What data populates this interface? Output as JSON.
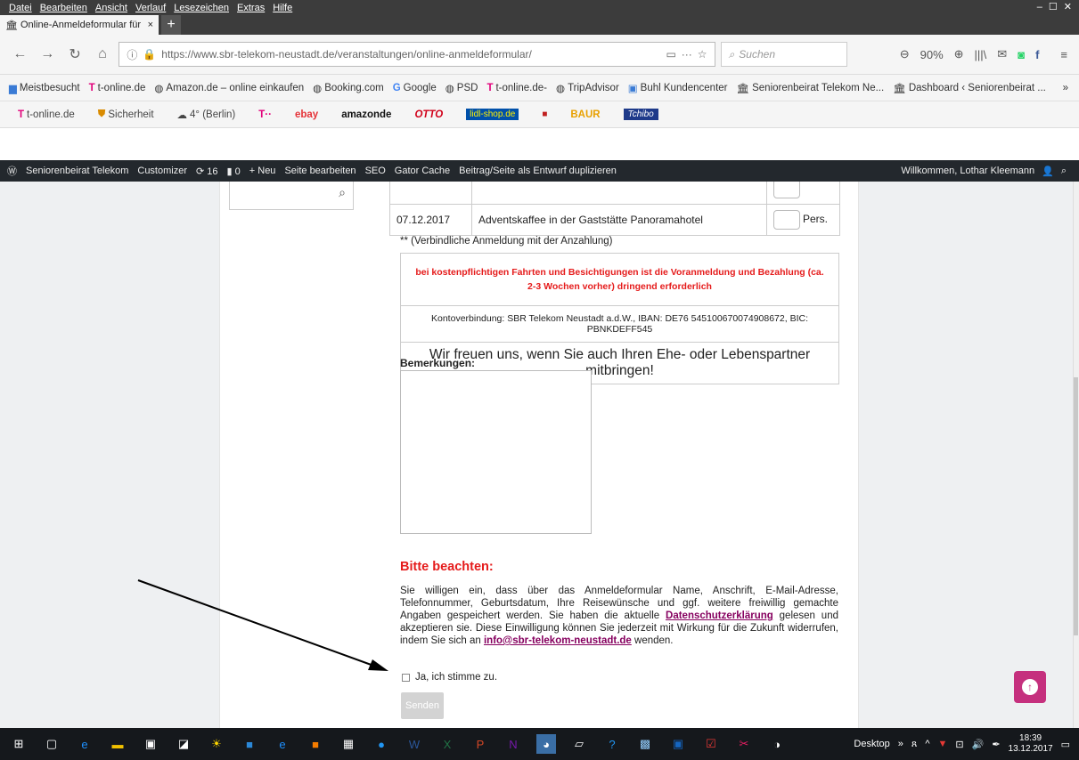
{
  "menubar": {
    "items": [
      "Datei",
      "Bearbeiten",
      "Ansicht",
      "Verlauf",
      "Lesezeichen",
      "Extras",
      "Hilfe"
    ],
    "window_controls": "– ☐ ✕"
  },
  "tab": {
    "title": "Online-Anmeldeformular für",
    "new_tab": "+"
  },
  "nav": {
    "url": "https://www.sbr-telekom-neustadt.de/veranstaltungen/online-anmeldeformular/",
    "url_menu": "···",
    "search_placeholder": "Suchen",
    "zoom": "90%"
  },
  "bookmarks": [
    "Meistbesucht",
    "t-online.de",
    "Amazon.de – online einkaufen",
    "Booking.com",
    "Google",
    "PSD",
    "t-online.de-",
    "TripAdvisor",
    "Buhl Kundencenter",
    "Seniorenbeirat Telekom Ne...",
    "Dashboard ‹ Seniorenbeirat ..."
  ],
  "tonline_bar": {
    "items": [
      "t-online.de",
      "Sicherheit",
      "4° (Berlin)",
      "T··",
      "ebay",
      "amazonde",
      "OTTO",
      "lidl-shop.de",
      "BAUR",
      "Tchibo"
    ]
  },
  "wpbar": {
    "items": [
      "Seniorenbeirat Telekom",
      "Customizer",
      "16",
      "0",
      "Neu",
      "Seite bearbeiten",
      "SEO",
      "Gator Cache",
      "Beitrag/Seite als Entwurf duplizieren"
    ],
    "greeting": "Willkommen, Lothar Kleemann"
  },
  "event": {
    "date": "07.12.2017",
    "title": "Adventskaffee in der Gaststätte Panoramahotel",
    "unit": "Pers."
  },
  "form": {
    "note": "** (Verbindliche Anmeldung mit der Anzahlung)",
    "warning": "bei kostenpflichtigen Fahrten und Besichtigungen ist die Voranmeldung und Bezahlung (ca. 2-3 Wochen vorher) dringend erforderlich",
    "bank": "Kontoverbindung: SBR Telekom Neustadt a.d.W., IBAN: DE76 545100670074908672, BIC: PBNKDEFF545",
    "partner": "Wir freuen uns, wenn Sie auch Ihren Ehe- oder Lebenspartner mitbringen!",
    "remarks_label": "Bemerkungen:",
    "attention": "Bitte beachten:",
    "consent_1": "Sie willigen ein, dass über das Anmeldeformular Name, Anschrift, E-Mail-Adresse, Telefonnummer, Geburtsdatum, Ihre Reisewünsche und ggf. weitere freiwillig gemachte Angaben gespeichert werden. Sie haben die aktuelle ",
    "privacy_link": "Datenschutzerklärung",
    "consent_2": " gelesen und akzeptieren sie. Diese Einwilligung können Sie jederzeit mit Wirkung für die Zukunft widerrufen, indem Sie sich an ",
    "email": "info@sbr-telekom-neustadt.de",
    "consent_3": " wenden.",
    "agree_label": "Ja, ich stimme zu.",
    "submit": "Senden"
  },
  "taskbar": {
    "desktop": "Desktop",
    "time": "18:39",
    "date": "13.12.2017"
  },
  "colors": {
    "accent_red": "#e51b1b",
    "link_purple": "#86005f",
    "back_to_top": "#c5307e",
    "wp_bar": "#23282d"
  }
}
